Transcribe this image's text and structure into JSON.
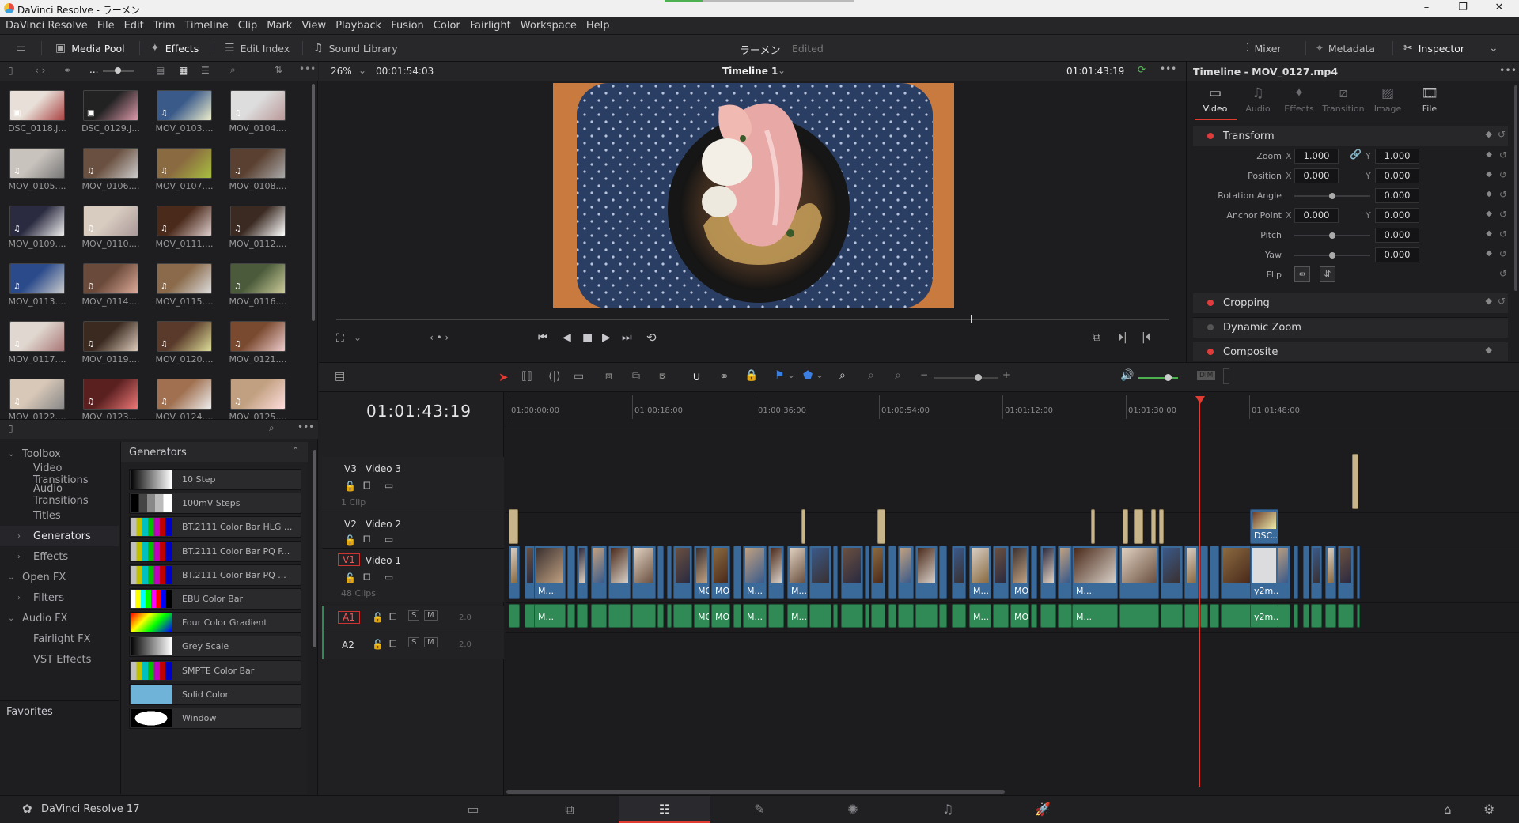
{
  "window": {
    "title": "DaVinci Resolve - ラーメン"
  },
  "menu": [
    "DaVinci Resolve",
    "File",
    "Edit",
    "Trim",
    "Timeline",
    "Clip",
    "Mark",
    "View",
    "Playback",
    "Fusion",
    "Color",
    "Fairlight",
    "Workspace",
    "Help"
  ],
  "toolbar": {
    "media_pool": "Media Pool",
    "effects": "Effects",
    "edit_index": "Edit Index",
    "sound_library": "Sound Library",
    "project_name": "ラーメン",
    "project_status": "Edited",
    "mixer": "Mixer",
    "metadata": "Metadata",
    "inspector": "Inspector"
  },
  "media_pool": {
    "bin_label": "...",
    "clips": [
      "DSC_0118.J...",
      "DSC_0129.J...",
      "MOV_0103....",
      "MOV_0104....",
      "MOV_0105....",
      "MOV_0106....",
      "MOV_0107....",
      "MOV_0108....",
      "MOV_0109....",
      "MOV_0110....",
      "MOV_0111....",
      "MOV_0112....",
      "MOV_0113....",
      "MOV_0114....",
      "MOV_0115....",
      "MOV_0116....",
      "MOV_0117....",
      "MOV_0119....",
      "MOV_0120....",
      "MOV_0121....",
      "MOV_0122....",
      "MOV_0123....",
      "MOV_0124....",
      "MOV_0125...."
    ]
  },
  "effects": {
    "tree": [
      {
        "label": "Toolbox",
        "level": 0,
        "arrow": "⌄"
      },
      {
        "label": "Video Transitions",
        "level": 1,
        "arrow": ""
      },
      {
        "label": "Audio Transitions",
        "level": 1,
        "arrow": ""
      },
      {
        "label": "Titles",
        "level": 1,
        "arrow": ""
      },
      {
        "label": "Generators",
        "level": 1,
        "arrow": "›",
        "selected": true
      },
      {
        "label": "Effects",
        "level": 1,
        "arrow": "›"
      },
      {
        "label": "Open FX",
        "level": 0,
        "arrow": "⌄"
      },
      {
        "label": "Filters",
        "level": 1,
        "arrow": "›"
      },
      {
        "label": "Audio FX",
        "level": 0,
        "arrow": "⌄"
      },
      {
        "label": "Fairlight FX",
        "level": 1,
        "arrow": ""
      },
      {
        "label": "VST Effects",
        "level": 1,
        "arrow": ""
      }
    ],
    "favorites": "Favorites",
    "list_title": "Generators",
    "generators": [
      "10 Step",
      "100mV Steps",
      "BT.2111 Color Bar HLG ...",
      "BT.2111 Color Bar PQ F...",
      "BT.2111 Color Bar PQ ...",
      "EBU Color Bar",
      "Four Color Gradient",
      "Grey Scale",
      "SMPTE Color Bar",
      "Solid Color",
      "Window"
    ]
  },
  "viewer": {
    "zoom": "26%",
    "duration": "00:01:54:03",
    "timeline_name": "Timeline 1",
    "timecode": "01:01:43:19"
  },
  "inspector": {
    "title": "Timeline - MOV_0127.mp4",
    "tabs": [
      "Video",
      "Audio",
      "Effects",
      "Transition",
      "Image",
      "File"
    ],
    "transform": "Transform",
    "zoom_label": "Zoom",
    "zoom_x": "1.000",
    "zoom_y": "1.000",
    "position_label": "Position",
    "pos_x": "0.000",
    "pos_y": "0.000",
    "rotation_label": "Rotation Angle",
    "rotation": "0.000",
    "anchor_label": "Anchor Point",
    "anchor_x": "0.000",
    "anchor_y": "0.000",
    "pitch_label": "Pitch",
    "pitch": "0.000",
    "yaw_label": "Yaw",
    "yaw": "0.000",
    "flip_label": "Flip",
    "axis_x": "X",
    "axis_y": "Y",
    "cropping": "Cropping",
    "dynamic_zoom": "Dynamic Zoom",
    "composite": "Composite"
  },
  "timeline": {
    "timecode": "01:01:43:19",
    "ruler": [
      "01:00:00:00",
      "01:00:18:00",
      "01:00:36:00",
      "01:00:54:00",
      "01:01:12:00",
      "01:01:30:00",
      "01:01:48:00"
    ],
    "tracks": {
      "v3": {
        "id": "V3",
        "name": "Video 3",
        "count": "1 Clip"
      },
      "v2": {
        "id": "V2",
        "name": "Video 2"
      },
      "v1": {
        "id": "V1",
        "name": "Video 1",
        "count": "48 Clips"
      },
      "a1": {
        "id": "A1",
        "level": "2.0"
      },
      "a2": {
        "id": "A2",
        "level": "2.0"
      },
      "solo": "S",
      "mute": "M"
    },
    "video_clip_labels": [
      "M...",
      "MO...",
      "MOV...",
      "M...",
      "M...",
      "MO...",
      "M...",
      "MOV...",
      "M...",
      "M...",
      "MOV_...",
      "MO...",
      "M...",
      "M...",
      "M...",
      "y2m..."
    ],
    "v2_clip_label": "DSC..."
  },
  "pagebar": {
    "product": "DaVinci Resolve 17"
  },
  "colors": {
    "accent_red": "#e03c31",
    "clip_blue": "#3a6a9a",
    "clip_green": "#2f8a55"
  }
}
